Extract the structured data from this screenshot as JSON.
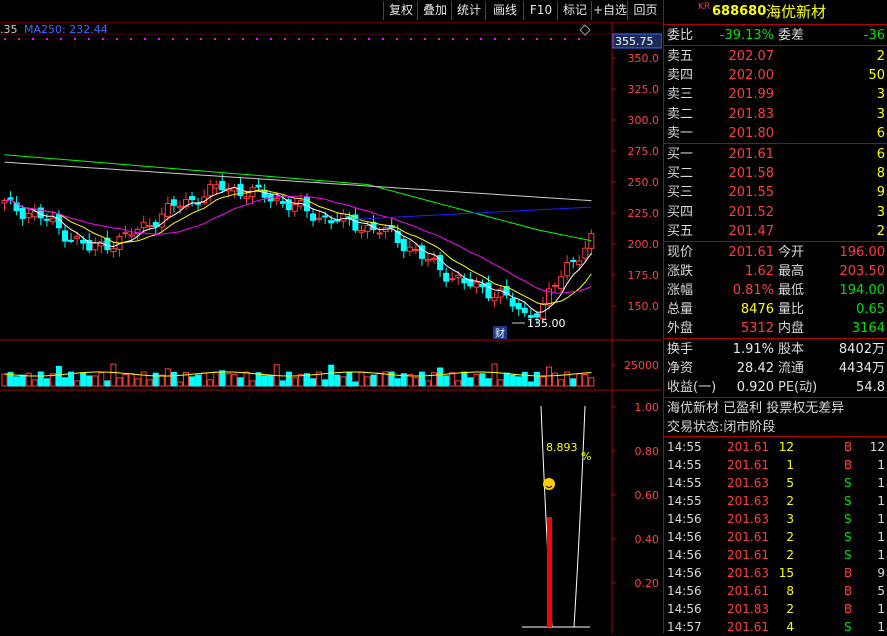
{
  "toolbar": {
    "items": [
      "复权",
      "叠加",
      "统计",
      "画线",
      "F10",
      "标记",
      "+自选",
      "回页"
    ]
  },
  "chart": {
    "ma_label_prefix": ".35",
    "ma_label": "MA250: 232.44",
    "last_price_tag": "355.75",
    "price_axis": [
      "350.0",
      "325.0",
      "300.0",
      "275.0",
      "250.0",
      "225.0",
      "200.0",
      "175.0",
      "150.0"
    ],
    "low_mark": "135.00",
    "fin_tag": "财",
    "volume_axis": "25000",
    "indicator_axis": [
      "1.00",
      "0.80",
      "0.60",
      "0.40",
      "0.20"
    ],
    "indicator_value": "8.893",
    "indicator_unit": "%",
    "colors": {
      "up": "#ff3b3b",
      "down": "#00ffff",
      "ma5": "#ffffff",
      "ma10": "#ffff00",
      "ma20": "#ff00ff",
      "ma60": "#00ff00",
      "ma120": "#2020ff",
      "ma250": "#cccccc",
      "grid": "#b00000"
    }
  },
  "stock": {
    "market_tag": "KR",
    "code": "688680",
    "name": "海优新材"
  },
  "order_ratio": {
    "label1": "委比",
    "value1": "-39.13%",
    "label2": "委差",
    "value2": "-36"
  },
  "asks": [
    {
      "label": "卖五",
      "price": "202.07",
      "vol": "2"
    },
    {
      "label": "卖四",
      "price": "202.00",
      "vol": "50"
    },
    {
      "label": "卖三",
      "price": "201.99",
      "vol": "3"
    },
    {
      "label": "卖二",
      "price": "201.83",
      "vol": "3"
    },
    {
      "label": "卖一",
      "price": "201.80",
      "vol": "6"
    }
  ],
  "bids": [
    {
      "label": "买一",
      "price": "201.61",
      "vol": "6"
    },
    {
      "label": "买二",
      "price": "201.58",
      "vol": "8"
    },
    {
      "label": "买三",
      "price": "201.55",
      "vol": "9"
    },
    {
      "label": "买四",
      "price": "201.52",
      "vol": "3"
    },
    {
      "label": "买五",
      "price": "201.47",
      "vol": "2"
    }
  ],
  "quote": [
    {
      "l1": "现价",
      "v1": "201.61",
      "c1": "red",
      "l2": "今开",
      "v2": "196.00",
      "c2": "red"
    },
    {
      "l1": "涨跌",
      "v1": "1.62",
      "c1": "red",
      "l2": "最高",
      "v2": "203.50",
      "c2": "red"
    },
    {
      "l1": "涨幅",
      "v1": "0.81%",
      "c1": "red",
      "l2": "最低",
      "v2": "194.00",
      "c2": "green"
    },
    {
      "l1": "总量",
      "v1": "8476",
      "c1": "yellow",
      "l2": "量比",
      "v2": "0.65",
      "c2": "green"
    },
    {
      "l1": "外盘",
      "v1": "5312",
      "c1": "red",
      "l2": "内盘",
      "v2": "3164",
      "c2": "green"
    }
  ],
  "stats": [
    {
      "l1": "换手",
      "v1": "1.91%",
      "l2": "股本",
      "v2": "8402万"
    },
    {
      "l1": "净资",
      "v1": "28.42",
      "l2": "流通",
      "v2": "4434万"
    },
    {
      "l1": "收益(一)",
      "v1": "0.920",
      "l2": "PE(动)",
      "v2": "54.8"
    }
  ],
  "info": {
    "line1": "海优新材 已盈利 投票权无差异",
    "line2": "交易状态:闭市阶段"
  },
  "ticks": [
    {
      "time": "14:55",
      "price": "201.61",
      "vol": "12",
      "side": "B",
      "n": "12"
    },
    {
      "time": "14:55",
      "price": "201.61",
      "vol": "1",
      "side": "B",
      "n": "1"
    },
    {
      "time": "14:55",
      "price": "201.63",
      "vol": "5",
      "side": "S",
      "n": "1"
    },
    {
      "time": "14:55",
      "price": "201.63",
      "vol": "2",
      "side": "S",
      "n": "1"
    },
    {
      "time": "14:56",
      "price": "201.63",
      "vol": "3",
      "side": "S",
      "n": "1"
    },
    {
      "time": "14:56",
      "price": "201.61",
      "vol": "2",
      "side": "S",
      "n": "1"
    },
    {
      "time": "14:56",
      "price": "201.61",
      "vol": "2",
      "side": "S",
      "n": "1"
    },
    {
      "time": "14:56",
      "price": "201.63",
      "vol": "15",
      "side": "B",
      "n": "9"
    },
    {
      "time": "14:56",
      "price": "201.61",
      "vol": "8",
      "side": "B",
      "n": "5"
    },
    {
      "time": "14:56",
      "price": "201.83",
      "vol": "2",
      "side": "B",
      "n": "1"
    },
    {
      "time": "14:57",
      "price": "201.61",
      "vol": "4",
      "side": "S",
      "n": "1"
    }
  ]
}
